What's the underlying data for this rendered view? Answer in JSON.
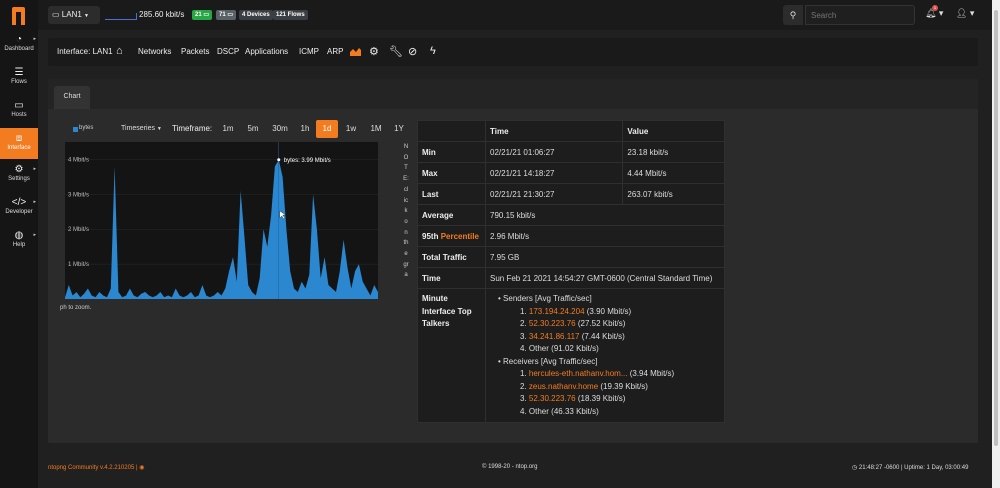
{
  "app": {
    "interface_selector": "LAN1",
    "throughput": "285.60 kbit/s",
    "badges": [
      {
        "text": "21",
        "icon": "laptop-icon",
        "color": "#28a745"
      },
      {
        "text": "71",
        "icon": "laptop-icon",
        "color": "#5a6268"
      },
      {
        "text": "4 Devices",
        "color": "#3a3f44"
      },
      {
        "text": "121 Flows",
        "color": "#3a3f44"
      }
    ],
    "search_placeholder": "Search",
    "notifications_count": "1",
    "accent_color": "#f47c20"
  },
  "sidebar": {
    "items": [
      {
        "label": "Dashboard",
        "icon": "gauge-icon"
      },
      {
        "label": "Flows",
        "icon": "stream-icon"
      },
      {
        "label": "Hosts",
        "icon": "laptop-icon"
      },
      {
        "label": "Interface",
        "icon": "ethernet-icon",
        "active": true
      },
      {
        "label": "Settings",
        "icon": "gear-icon"
      },
      {
        "label": "Developer",
        "icon": "code-icon"
      },
      {
        "label": "Help",
        "icon": "life-ring-icon"
      }
    ]
  },
  "navbar": {
    "title": "Interface: LAN1",
    "links": [
      "Networks",
      "Packets",
      "DSCP",
      "Applications",
      "ICMP",
      "ARP"
    ],
    "icons": [
      "home-icon",
      "chart-area-icon",
      "gear-icon",
      "wrench-icon",
      "user-slash-icon",
      "bolt-icon"
    ]
  },
  "tabs": [
    "Chart"
  ],
  "chart": {
    "legend": "bytes",
    "view_dropdown": "Timeseries",
    "timeframe_label": "Timeframe:",
    "timeframes": [
      "1m",
      "5m",
      "30m",
      "1h",
      "1d",
      "1w",
      "1M",
      "1Y"
    ],
    "active_timeframe": "1d",
    "tooltip": "bytes: 3.99 Mbit/s",
    "vertical_notice": [
      "N",
      "O",
      "T",
      "E:",
      "cl",
      "ic",
      "k",
      "o",
      "n",
      "th",
      "e",
      "gr",
      "a"
    ],
    "zoom_hint": "ph to zoom."
  },
  "chart_data": {
    "type": "area",
    "title": "",
    "xlabel": "",
    "ylabel": "",
    "yticks": [
      "1 Mbit/s",
      "2 Mbit/s",
      "3 Mbit/s",
      "4 Mbit/s"
    ],
    "ylim": [
      0,
      4.5
    ],
    "series": [
      {
        "name": "bytes",
        "color": "#2a87d0",
        "values": [
          0.05,
          0.4,
          0.1,
          0.2,
          0.05,
          0.15,
          0.3,
          0.1,
          0.05,
          0.2,
          0.1,
          0.05,
          0.3,
          3.8,
          0.2,
          0.05,
          0.1,
          0.3,
          0.1,
          0.05,
          0.15,
          0.2,
          0.1,
          0.05,
          0.1,
          0.2,
          0.05,
          0.1,
          0.05,
          0.3,
          0.1,
          0.05,
          0.1,
          0.2,
          0.05,
          0.1,
          0.4,
          0.1,
          0.05,
          0.1,
          0.2,
          0.1,
          0.3,
          0.8,
          1.2,
          0.5,
          3.1,
          1.8,
          0.4,
          0.2,
          0.1,
          0.6,
          2.0,
          1.5,
          2.4,
          3.8,
          3.99,
          3.5,
          2.0,
          0.8,
          0.3,
          0.2,
          0.5,
          0.3,
          0.7,
          3.0,
          2.0,
          0.6,
          1.2,
          0.4,
          0.3,
          0.2,
          0.8,
          1.7,
          0.9,
          0.3,
          0.8,
          1.0,
          0.5,
          0.3,
          0.1,
          0.4,
          0.2
        ]
      }
    ],
    "grid": true,
    "legend_position": "top-left"
  },
  "stats": {
    "headers": [
      "",
      "Time",
      "Value"
    ],
    "rows": [
      {
        "label": "Min",
        "time": "02/21/21 01:06:27",
        "value": "23.18 kbit/s"
      },
      {
        "label": "Max",
        "time": "02/21/21 14:18:27",
        "value": "4.44 Mbit/s"
      },
      {
        "label": "Last",
        "time": "02/21/21 21:30:27",
        "value": "263.07 kbit/s"
      }
    ],
    "average_label": "Average",
    "average": "790.15 kbit/s",
    "percentile_label_a": "95th",
    "percentile_label_b": "Percentile",
    "percentile": "2.96 Mbit/s",
    "total_traffic_label": "Total Traffic",
    "total_traffic": "7.95 GB",
    "time_label": "Time",
    "time": "Sun Feb 21 2021 14:54:27 GMT-0600 (Central Standard Time)",
    "talkers_label": "Minute Interface Top Talkers",
    "senders_title": "Senders [Avg Traffic/sec]",
    "senders": [
      {
        "n": "1.",
        "host": "173.194.24.204",
        "rate": "(3.90 Mbit/s)"
      },
      {
        "n": "2.",
        "host": "52.30.223.76",
        "rate": "(27.52 Kbit/s)"
      },
      {
        "n": "3.",
        "host": "34.241.86.117",
        "rate": "(7.44 Kbit/s)"
      },
      {
        "n": "4.",
        "host": "Other",
        "rate": "(91.02 Kbit/s)"
      }
    ],
    "receivers_title": "Receivers [Avg Traffic/sec]",
    "receivers": [
      {
        "n": "1.",
        "host": "hercules-eth.nathanv.hom...",
        "rate": "(3.94 Mbit/s)"
      },
      {
        "n": "2.",
        "host": "zeus.nathanv.home",
        "rate": "(19.39 Kbit/s)"
      },
      {
        "n": "3.",
        "host": "52.30.223.76",
        "rate": "(18.39 Kbit/s)"
      },
      {
        "n": "4.",
        "host": "Other",
        "rate": "(46.33 Kbit/s)"
      }
    ]
  },
  "footer": {
    "version": "ntopng Community v.4.2.210205 |",
    "copyright": "© 1998-20 - ntop.org",
    "uptime": "21:48:27 -0600 | Uptime: 1 Day, 03:00:49"
  }
}
